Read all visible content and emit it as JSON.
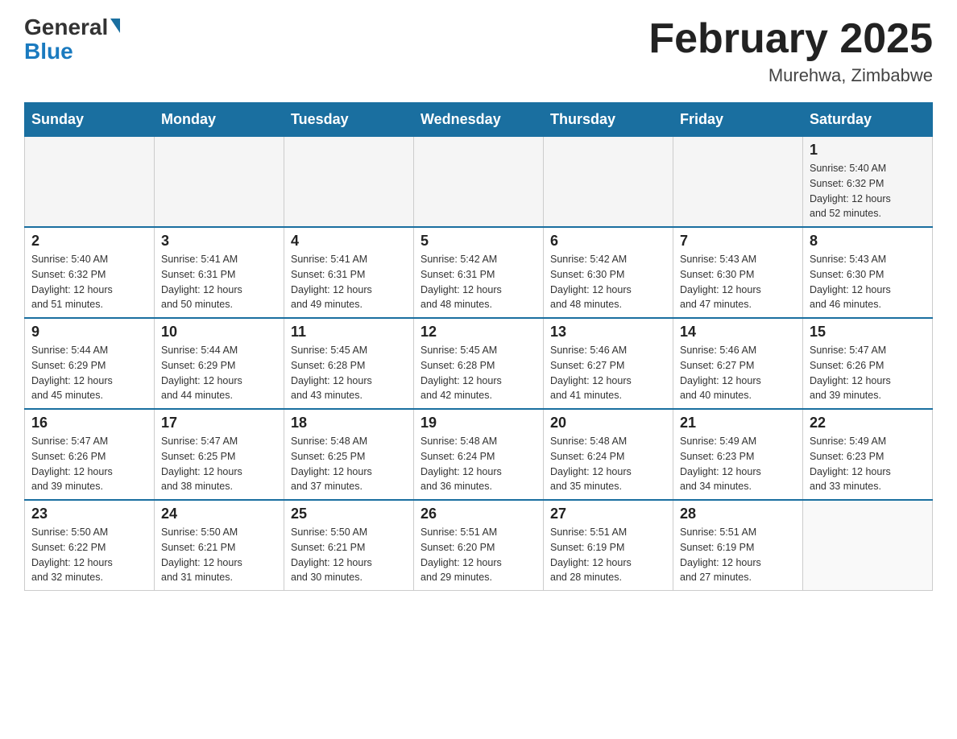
{
  "header": {
    "logo_general": "General",
    "logo_blue": "Blue",
    "month_title": "February 2025",
    "location": "Murehwa, Zimbabwe"
  },
  "days_of_week": [
    "Sunday",
    "Monday",
    "Tuesday",
    "Wednesday",
    "Thursday",
    "Friday",
    "Saturday"
  ],
  "weeks": [
    [
      {
        "day": "",
        "info": ""
      },
      {
        "day": "",
        "info": ""
      },
      {
        "day": "",
        "info": ""
      },
      {
        "day": "",
        "info": ""
      },
      {
        "day": "",
        "info": ""
      },
      {
        "day": "",
        "info": ""
      },
      {
        "day": "1",
        "info": "Sunrise: 5:40 AM\nSunset: 6:32 PM\nDaylight: 12 hours\nand 52 minutes."
      }
    ],
    [
      {
        "day": "2",
        "info": "Sunrise: 5:40 AM\nSunset: 6:32 PM\nDaylight: 12 hours\nand 51 minutes."
      },
      {
        "day": "3",
        "info": "Sunrise: 5:41 AM\nSunset: 6:31 PM\nDaylight: 12 hours\nand 50 minutes."
      },
      {
        "day": "4",
        "info": "Sunrise: 5:41 AM\nSunset: 6:31 PM\nDaylight: 12 hours\nand 49 minutes."
      },
      {
        "day": "5",
        "info": "Sunrise: 5:42 AM\nSunset: 6:31 PM\nDaylight: 12 hours\nand 48 minutes."
      },
      {
        "day": "6",
        "info": "Sunrise: 5:42 AM\nSunset: 6:30 PM\nDaylight: 12 hours\nand 48 minutes."
      },
      {
        "day": "7",
        "info": "Sunrise: 5:43 AM\nSunset: 6:30 PM\nDaylight: 12 hours\nand 47 minutes."
      },
      {
        "day": "8",
        "info": "Sunrise: 5:43 AM\nSunset: 6:30 PM\nDaylight: 12 hours\nand 46 minutes."
      }
    ],
    [
      {
        "day": "9",
        "info": "Sunrise: 5:44 AM\nSunset: 6:29 PM\nDaylight: 12 hours\nand 45 minutes."
      },
      {
        "day": "10",
        "info": "Sunrise: 5:44 AM\nSunset: 6:29 PM\nDaylight: 12 hours\nand 44 minutes."
      },
      {
        "day": "11",
        "info": "Sunrise: 5:45 AM\nSunset: 6:28 PM\nDaylight: 12 hours\nand 43 minutes."
      },
      {
        "day": "12",
        "info": "Sunrise: 5:45 AM\nSunset: 6:28 PM\nDaylight: 12 hours\nand 42 minutes."
      },
      {
        "day": "13",
        "info": "Sunrise: 5:46 AM\nSunset: 6:27 PM\nDaylight: 12 hours\nand 41 minutes."
      },
      {
        "day": "14",
        "info": "Sunrise: 5:46 AM\nSunset: 6:27 PM\nDaylight: 12 hours\nand 40 minutes."
      },
      {
        "day": "15",
        "info": "Sunrise: 5:47 AM\nSunset: 6:26 PM\nDaylight: 12 hours\nand 39 minutes."
      }
    ],
    [
      {
        "day": "16",
        "info": "Sunrise: 5:47 AM\nSunset: 6:26 PM\nDaylight: 12 hours\nand 39 minutes."
      },
      {
        "day": "17",
        "info": "Sunrise: 5:47 AM\nSunset: 6:25 PM\nDaylight: 12 hours\nand 38 minutes."
      },
      {
        "day": "18",
        "info": "Sunrise: 5:48 AM\nSunset: 6:25 PM\nDaylight: 12 hours\nand 37 minutes."
      },
      {
        "day": "19",
        "info": "Sunrise: 5:48 AM\nSunset: 6:24 PM\nDaylight: 12 hours\nand 36 minutes."
      },
      {
        "day": "20",
        "info": "Sunrise: 5:48 AM\nSunset: 6:24 PM\nDaylight: 12 hours\nand 35 minutes."
      },
      {
        "day": "21",
        "info": "Sunrise: 5:49 AM\nSunset: 6:23 PM\nDaylight: 12 hours\nand 34 minutes."
      },
      {
        "day": "22",
        "info": "Sunrise: 5:49 AM\nSunset: 6:23 PM\nDaylight: 12 hours\nand 33 minutes."
      }
    ],
    [
      {
        "day": "23",
        "info": "Sunrise: 5:50 AM\nSunset: 6:22 PM\nDaylight: 12 hours\nand 32 minutes."
      },
      {
        "day": "24",
        "info": "Sunrise: 5:50 AM\nSunset: 6:21 PM\nDaylight: 12 hours\nand 31 minutes."
      },
      {
        "day": "25",
        "info": "Sunrise: 5:50 AM\nSunset: 6:21 PM\nDaylight: 12 hours\nand 30 minutes."
      },
      {
        "day": "26",
        "info": "Sunrise: 5:51 AM\nSunset: 6:20 PM\nDaylight: 12 hours\nand 29 minutes."
      },
      {
        "day": "27",
        "info": "Sunrise: 5:51 AM\nSunset: 6:19 PM\nDaylight: 12 hours\nand 28 minutes."
      },
      {
        "day": "28",
        "info": "Sunrise: 5:51 AM\nSunset: 6:19 PM\nDaylight: 12 hours\nand 27 minutes."
      },
      {
        "day": "",
        "info": ""
      }
    ]
  ]
}
